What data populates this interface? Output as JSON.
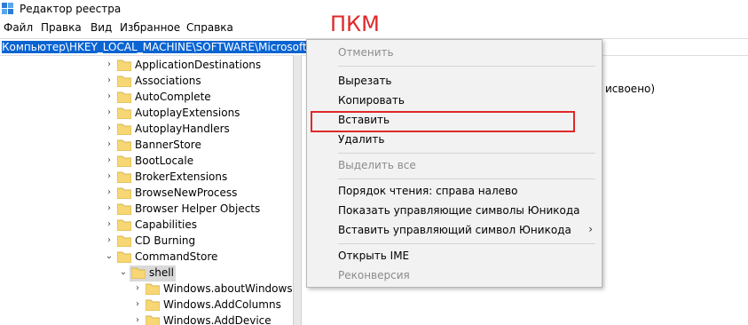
{
  "window": {
    "title": "Редактор реестра"
  },
  "menu": [
    "Файл",
    "Правка",
    "Вид",
    "Избранное",
    "Справка"
  ],
  "address": {
    "path": "Компьютер\\HKEY_LOCAL_MACHINE\\SOFTWARE\\Microsoft\\Windows\\CurrentVersion\\Explorer\\CommandStore\\shell"
  },
  "annotation": {
    "label": "ПКМ"
  },
  "tree": {
    "items": [
      {
        "label": "ApplicationDestinations"
      },
      {
        "label": "Associations"
      },
      {
        "label": "AutoComplete"
      },
      {
        "label": "AutoplayExtensions"
      },
      {
        "label": "AutoplayHandlers"
      },
      {
        "label": "BannerStore"
      },
      {
        "label": "BootLocale"
      },
      {
        "label": "BrokerExtensions"
      },
      {
        "label": "BrowseNewProcess"
      },
      {
        "label": "Browser Helper Objects"
      },
      {
        "label": "Capabilities"
      },
      {
        "label": "CD Burning"
      },
      {
        "label": "CommandStore"
      },
      {
        "label": "shell"
      },
      {
        "label": "Windows.aboutWindows"
      },
      {
        "label": "Windows.AddColumns"
      },
      {
        "label": "Windows.AddDevice"
      }
    ]
  },
  "right_pane": {
    "value_text": "исвоено)"
  },
  "context_menu": {
    "undo": "Отменить",
    "cut": "Вырезать",
    "copy": "Копировать",
    "paste": "Вставить",
    "delete": "Удалить",
    "select_all": "Выделить все",
    "rtl": "Порядок чтения: справа налево",
    "show_unicode": "Показать управляющие символы Юникода",
    "insert_unicode": "Вставить управляющий символ Юникода",
    "open_ime": "Открыть IME",
    "reconversion": "Реконверсия",
    "submenu_arrow": "›"
  },
  "colors": {
    "selection": "#0a64d2",
    "annotation_red": "#e0282a",
    "folder": "#f7d674"
  }
}
